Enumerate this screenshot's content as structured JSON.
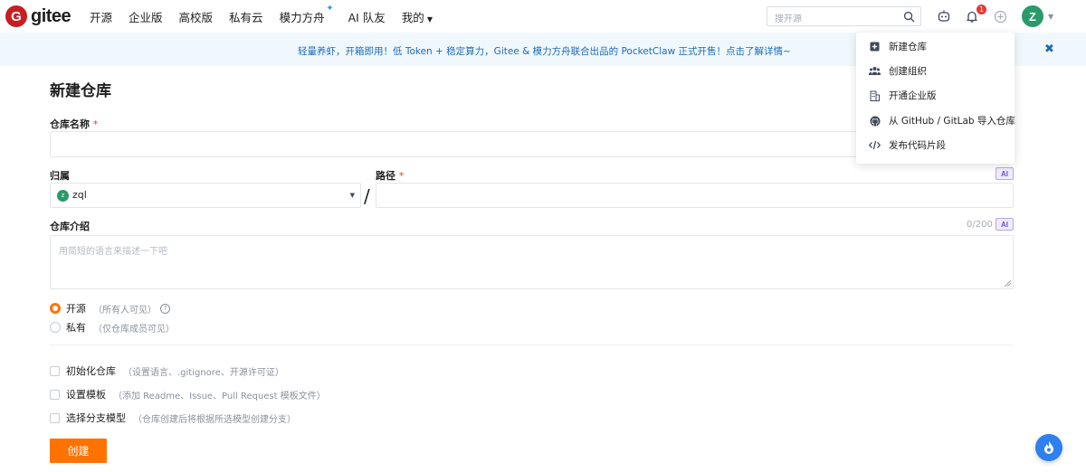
{
  "nav": {
    "logo_mark": "G",
    "logo_text": "gitee",
    "items": [
      "开源",
      "企业版",
      "高校版",
      "私有云",
      "模力方舟",
      "AI 队友",
      "我的"
    ],
    "spark": "✦",
    "search_placeholder": "搜开源",
    "notification_count": "1",
    "avatar_letter": "Z"
  },
  "banner": {
    "text": "轻量养虾，开箱即用！低 Token + 稳定算力，Gitee & 模力方舟联合出品的 PocketClaw 正式开售！点击了解详情~",
    "close": "✖"
  },
  "dropdown": {
    "items": [
      {
        "label": "新建仓库",
        "icon": "plus-square-icon"
      },
      {
        "label": "创建组织",
        "icon": "group-icon"
      },
      {
        "label": "开通企业版",
        "icon": "building-icon"
      },
      {
        "label": "从 GitHub / GitLab 导入仓库",
        "icon": "github-icon"
      },
      {
        "label": "发布代码片段",
        "icon": "code-icon"
      }
    ]
  },
  "form": {
    "title": "新建仓库",
    "repo_name_label": "仓库名称",
    "required_mark": "*",
    "owner_label": "归属",
    "owner_value": "zql",
    "owner_avatar_letter": "z",
    "path_label": "路径",
    "ai_badge": "AI",
    "slash": "/",
    "intro_label": "仓库介绍",
    "intro_counter": "0/200",
    "intro_placeholder": "用简短的语言来描述一下吧",
    "visibility": [
      {
        "label": "开源",
        "hint": "（所有人可见）",
        "selected": true
      },
      {
        "label": "私有",
        "hint": "（仅仓库成员可见）",
        "selected": false
      }
    ],
    "help_glyph": "?",
    "options": [
      {
        "label": "初始化仓库",
        "hint": "（设置语言、.gitignore、开源许可证）"
      },
      {
        "label": "设置模板",
        "hint": "（添加 Readme、Issue、Pull Request 模板文件）"
      },
      {
        "label": "选择分支模型",
        "hint": "（仓库创建后将根据所选模型创建分支）"
      }
    ],
    "create_button": "创建"
  },
  "colors": {
    "brand_red": "#c71d23",
    "accent_orange": "#fe7300",
    "banner_bg": "#f0f8fd",
    "banner_text": "#1e6bb8"
  }
}
